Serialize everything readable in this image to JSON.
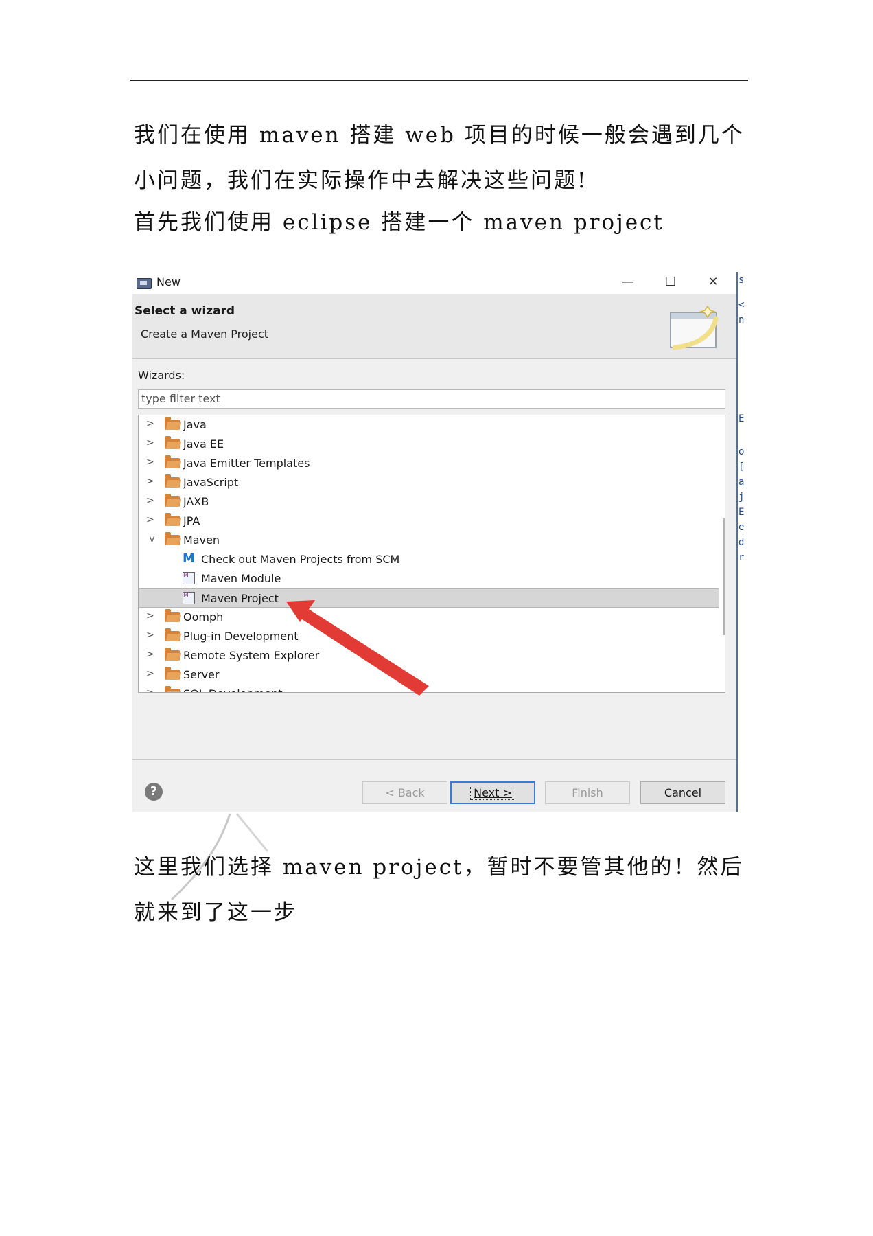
{
  "doc": {
    "para1": "我们在使用 maven 搭建 web 项目的时候一般会遇到几个小问题，我们在实际操作中去解决这些问题!",
    "para2": "首先我们使用 eclipse 搭建一个 maven project",
    "para3": "这里我们选择 maven project，暂时不要管其他的！然后就来到了这一步"
  },
  "dialog": {
    "title": "New",
    "minimize": "—",
    "maximize": "☐",
    "close": "✕",
    "header_title": "Select a wizard",
    "header_subtitle": "Create a Maven Project",
    "wizards_label": "Wizards:",
    "filter_placeholder": "type filter text",
    "tree": [
      {
        "label": "Java"
      },
      {
        "label": "Java EE"
      },
      {
        "label": "Java Emitter Templates"
      },
      {
        "label": "JavaScript"
      },
      {
        "label": "JAXB"
      },
      {
        "label": "JPA"
      },
      {
        "label": "Maven"
      },
      {
        "label": "Check out Maven Projects from SCM"
      },
      {
        "label": "Maven Module"
      },
      {
        "label": "Maven Project"
      },
      {
        "label": "Oomph"
      },
      {
        "label": "Plug-in Development"
      },
      {
        "label": "Remote System Explorer"
      },
      {
        "label": "Server"
      },
      {
        "label": "SQL Development"
      }
    ],
    "buttons": {
      "help": "?",
      "back": "< Back",
      "next": "Next >",
      "finish": "Finish",
      "cancel": "Cancel"
    },
    "colors": {
      "accent": "#3b7bd6",
      "arrow": "#e23b35",
      "folder": "#d4833a",
      "selection": "#d6d6d6"
    }
  }
}
